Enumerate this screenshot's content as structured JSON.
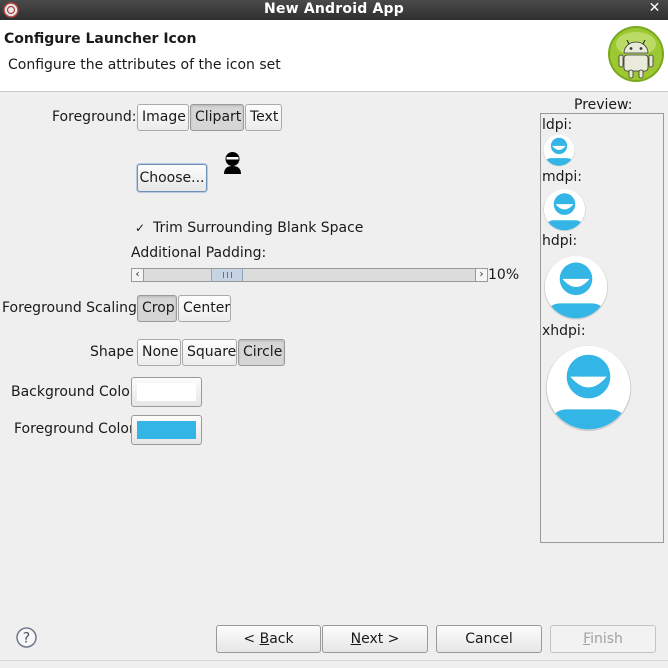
{
  "window": {
    "title": "New Android App",
    "close_glyph": "✕"
  },
  "header": {
    "title": "Configure Launcher Icon",
    "subtitle": "Configure the attributes of the icon set",
    "logo_icon": "android-logo-icon"
  },
  "foreground": {
    "label": "Foreground:",
    "options": [
      "Image",
      "Clipart",
      "Text"
    ],
    "selected": "Clipart"
  },
  "choose_button": "Choose...",
  "clipart_icon": "person-icon",
  "trim": {
    "label": "Trim Surrounding Blank Space",
    "checked": true,
    "glyph": "✓"
  },
  "padding": {
    "label": "Additional Padding:",
    "value_text": "10%",
    "left_arrow": "‹",
    "right_arrow": "›"
  },
  "scaling": {
    "label": "Foreground Scaling:",
    "options": [
      "Crop",
      "Center"
    ],
    "selected": "Crop"
  },
  "shape": {
    "label": "Shape",
    "options": [
      "None",
      "Square",
      "Circle"
    ],
    "selected": "Circle"
  },
  "background_color": {
    "label": "Background Color:",
    "value": "#ffffff"
  },
  "foreground_color": {
    "label": "Foreground Color:",
    "value": "#33b5e5"
  },
  "preview": {
    "title": "Preview:",
    "densities": [
      "ldpi:",
      "mdpi:",
      "hdpi:",
      "xhdpi:"
    ]
  },
  "buttons": {
    "back": "< Back",
    "next": "Next >",
    "cancel": "Cancel",
    "finish": "Finish"
  },
  "help_glyph": "?",
  "colors": {
    "accent": "#33b5e5",
    "android_green": "#a4c639"
  }
}
